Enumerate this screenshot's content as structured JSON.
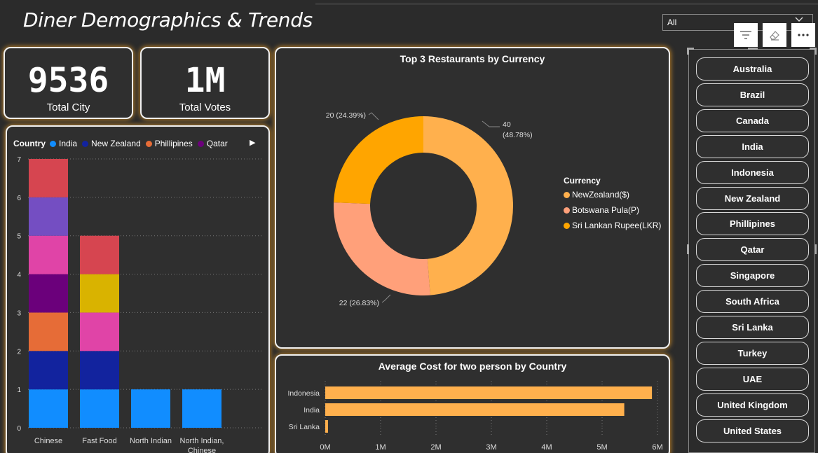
{
  "header": {
    "title": "Diner Demographics & Trends"
  },
  "kpis": [
    {
      "value": "9536",
      "label": "Total City"
    },
    {
      "value": "1M",
      "label": "Total Votes"
    }
  ],
  "filter": {
    "selected": "All"
  },
  "colors": {
    "india": "#118dff",
    "new_zealand": "#12239e",
    "phillipines": "#e66c37",
    "qatar": "#6b007b",
    "orange": "#ffa500",
    "light_orange": "#ffb04d",
    "salmon": "#ffa07a"
  },
  "stacked_chart": {
    "legend_title": "Country",
    "legend": [
      {
        "name": "India",
        "color": "#118dff"
      },
      {
        "name": "New Zealand",
        "color": "#12239e"
      },
      {
        "name": "Phillipines",
        "color": "#e66c37"
      },
      {
        "name": "Qatar",
        "color": "#6b007b"
      }
    ]
  },
  "donut_chart": {
    "title": "Top 3 Restaurants by Currency",
    "legend_title": "Currency",
    "labels": [
      "40 (48.78%)",
      "22 (26.83%)",
      "20 (24.39%)"
    ]
  },
  "bar_chart": {
    "title": "Average Cost for two person by Country"
  },
  "chart_data": [
    {
      "type": "bar",
      "stacked": true,
      "categories": [
        "Chinese",
        "Fast Food",
        "North Indian",
        "North Indian, Chinese"
      ],
      "ylim": [
        0,
        7
      ],
      "yticks": [
        0,
        1,
        2,
        3,
        4,
        5,
        6,
        7
      ],
      "grid": true,
      "series": [
        {
          "name": "India",
          "color": "#118dff",
          "values": [
            1,
            1,
            1,
            1
          ]
        },
        {
          "name": "New Zealand",
          "color": "#12239e",
          "values": [
            1,
            1,
            0,
            0
          ]
        },
        {
          "name": "Phillipines",
          "color": "#e66c37",
          "values": [
            1,
            0,
            0,
            0
          ]
        },
        {
          "name": "Qatar",
          "color": "#6b007b",
          "values": [
            1,
            0,
            0,
            0
          ]
        },
        {
          "color": "#e044a7",
          "values": [
            1,
            1,
            0,
            0
          ]
        },
        {
          "color": "#744ec2",
          "values": [
            1,
            0,
            0,
            0
          ]
        },
        {
          "color": "#d9b300",
          "values": [
            0,
            1,
            0,
            0
          ]
        },
        {
          "color": "#d64550",
          "values": [
            1,
            1,
            0,
            0
          ]
        }
      ]
    },
    {
      "type": "pie",
      "title": "Top 3 Restaurants by Currency",
      "categories": [
        "NewZealand($)",
        "Botswana Pula(P)",
        "Sri Lankan Rupee(LKR)"
      ],
      "values": [
        40,
        22,
        20
      ],
      "colors": [
        "#ffb04d",
        "#ffa07a",
        "#ffa500"
      ],
      "legend": "right"
    },
    {
      "type": "bar",
      "orientation": "horizontal",
      "title": "Average Cost for two person by Country",
      "categories": [
        "Indonesia",
        "India",
        "Sri Lanka"
      ],
      "values": [
        5.9,
        5.4,
        0.05
      ],
      "xticks": [
        "0M",
        "1M",
        "2M",
        "3M",
        "4M",
        "5M",
        "6M"
      ],
      "xlim": [
        0,
        6
      ],
      "color": "#ffb04d"
    }
  ],
  "slicer": {
    "items": [
      "Australia",
      "Brazil",
      "Canada",
      "India",
      "Indonesia",
      "New Zealand",
      "Phillipines",
      "Qatar",
      "Singapore",
      "South Africa",
      "Sri Lanka",
      "Turkey",
      "UAE",
      "United Kingdom",
      "United States"
    ]
  }
}
